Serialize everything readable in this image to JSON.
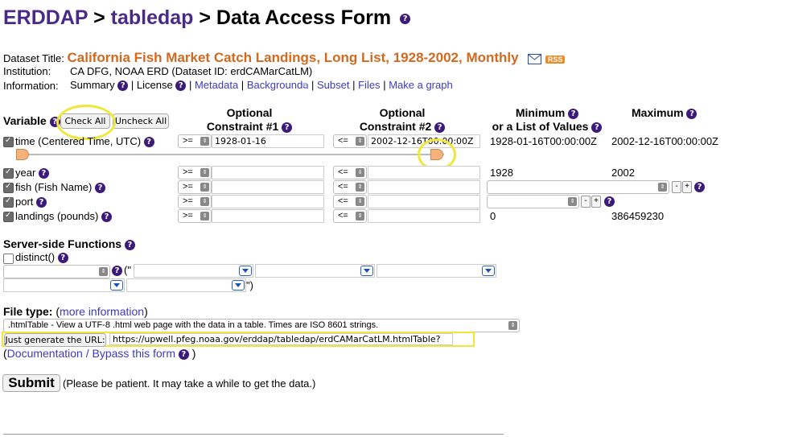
{
  "header": {
    "erddap": "ERDDAP",
    "sep1": " > ",
    "tabledap": "tabledap",
    "sep2": " > ",
    "title": "Data Access Form",
    "help": "?"
  },
  "dataset": {
    "title_label": "Dataset Title:",
    "title": "California Fish Market Catch Landings, Long List, 1928-2002, Monthly",
    "rss": "RSS",
    "institution_label": "Institution:",
    "institution": "CA DFG, NOAA ERD   (Dataset ID: erdCAMarCatLM)",
    "information_label": "Information:",
    "links": {
      "summary": "Summary",
      "license": "License",
      "metadata": "Metadata",
      "background": "Background",
      "subset": "Subset",
      "files": "Files",
      "graph": "Make a graph"
    },
    "pipe": "|"
  },
  "table": {
    "variable": "Variable",
    "check_all": "Check All",
    "uncheck_all": "Uncheck All",
    "c1_line1": "Optional",
    "c1_line2": "Constraint #1",
    "c2_line1": "Optional",
    "c2_line2": "Constraint #2",
    "min_line1": "Minimum",
    "min_line2": "or a List of Values",
    "max": "Maximum",
    "rows": [
      {
        "name": "time (Centered Time, UTC)",
        "op1": ">=",
        "val1": "1928-01-16",
        "op2": "<=",
        "val2": "2002-12-16T00:00:00Z",
        "min": "1928-01-16T00:00:00Z",
        "max": "2002-12-16T00:00:00Z"
      },
      {
        "name": "year",
        "op1": ">=",
        "val1": "",
        "op2": "<=",
        "val2": "",
        "min": "1928",
        "max": "2002"
      },
      {
        "name": "fish (Fish Name)",
        "op1": ">=",
        "val1": "",
        "op2": "<=",
        "val2": "",
        "min": "",
        "max": ""
      },
      {
        "name": "port",
        "op1": ">=",
        "val1": "",
        "op2": "<=",
        "val2": "",
        "min": "",
        "max": ""
      },
      {
        "name": "landings (pounds)",
        "op1": ">=",
        "val1": "",
        "op2": "<=",
        "val2": "",
        "min": "0",
        "max": "386459230"
      }
    ],
    "plus": "+",
    "minus": "-"
  },
  "server": {
    "title": "Server-side Functions",
    "distinct": "distinct()",
    "quote_open": "(\"",
    "quote_close": "\")"
  },
  "filetype": {
    "label": "File type:",
    "more_open": "(",
    "more": "more information",
    "more_close": ")",
    "selected": ".htmlTable - View a UTF-8 .html web page with the data in a table. Times are ISO 8601 strings.",
    "gen_button": "Just generate the URL:",
    "url": "https://upwell.pfeg.noaa.gov/erddap/tabledap/erdCAMarCatLM.htmlTable?time%",
    "docs_open": "(",
    "docs": "Documentation / Bypass this form",
    "docs_close": ")"
  },
  "submit": {
    "label": "Submit",
    "note": "(Please be patient. It may take a while to get the data.)"
  },
  "colors": {
    "erddap_purple": "#4a2a86",
    "title_orange": "#d2691e",
    "link_blue": "#3b3bbf",
    "highlight_yellow": "#f0e63c",
    "slider_orange": "#f5b27a"
  }
}
